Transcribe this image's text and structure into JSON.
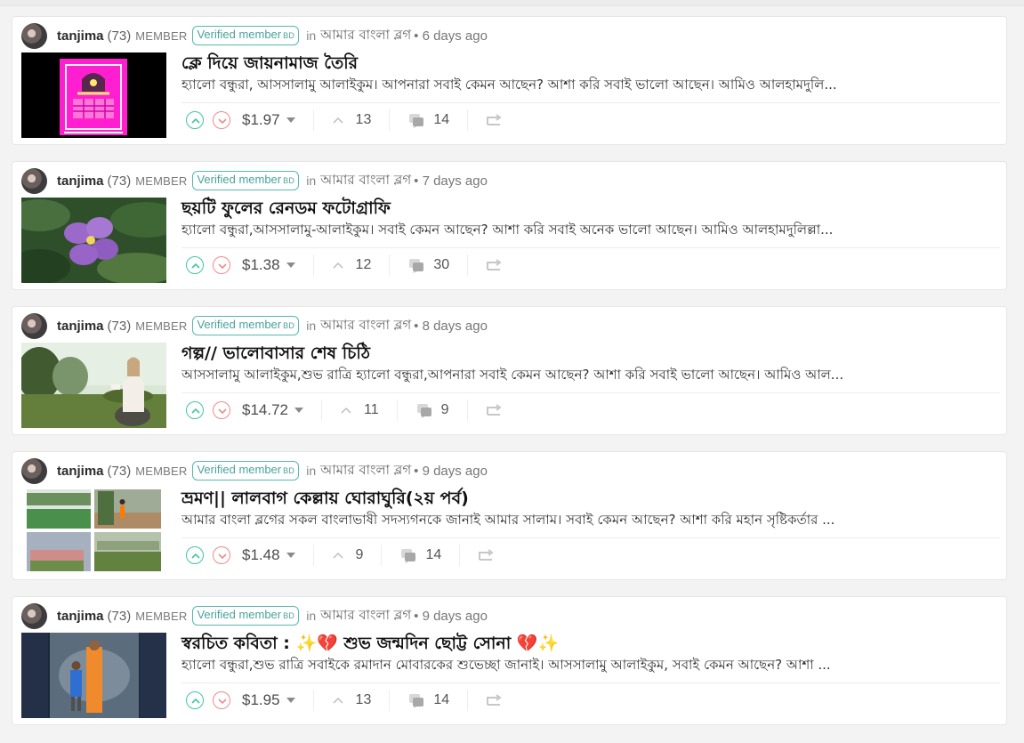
{
  "posts": [
    {
      "author": "tanjima",
      "reputation": "(73)",
      "role": "MEMBER",
      "badge_main": "Verified member",
      "badge_suffix": "BD",
      "in_label": "in",
      "community": "আমার বাংলা ব্লগ",
      "time": "• 6 days ago",
      "title": "ক্লে দিয়ে জায়নামাজ তৈরি",
      "excerpt": "হ্যালো বন্ধুরা, আসসালামু আলাইকুম। আপনারা সবাই কেমন আছেন? আশা করি সবাই ভালো আছেন। আমিও আলহামদুলি...",
      "payout": "$1.97",
      "votes": "13",
      "comments": "14",
      "thumb_type": "prayer-mat-clay"
    },
    {
      "author": "tanjima",
      "reputation": "(73)",
      "role": "MEMBER",
      "badge_main": "Verified member",
      "badge_suffix": "BD",
      "in_label": "in",
      "community": "আমার বাংলা ব্লগ",
      "time": "• 7 days ago",
      "title": "ছয়টি ফুলের রেনডম ফটোগ্রাফি",
      "excerpt": "হ্যালো বন্ধুরা,আসসালামু-আলাইকুম। সবাই কেমন আছেন? আশা করি সবাই অনেক ভালো আছেন। আমিও আলহামদুলিল্লা...",
      "payout": "$1.38",
      "votes": "12",
      "comments": "30",
      "thumb_type": "purple-flower"
    },
    {
      "author": "tanjima",
      "reputation": "(73)",
      "role": "MEMBER",
      "badge_main": "Verified member",
      "badge_suffix": "BD",
      "in_label": "in",
      "community": "আমার বাংলা ব্লগ",
      "time": "• 8 days ago",
      "title": "গল্প// ভালোবাসার শেষ চিঠি",
      "excerpt": "আসসালামু আলাইকুম,শুভ রাত্রি হ্যালো বন্ধুরা,আপনারা সবাই কেমন আছেন? আশা করি সবাই ভালো আছেন। আমিও আল...",
      "payout": "$14.72",
      "votes": "11",
      "comments": "9",
      "thumb_type": "woman-field"
    },
    {
      "author": "tanjima",
      "reputation": "(73)",
      "role": "MEMBER",
      "badge_main": "Verified member",
      "badge_suffix": "BD",
      "in_label": "in",
      "community": "আমার বাংলা ব্লগ",
      "time": "• 9 days ago",
      "title": "ভ্রমণ|| লালবাগ কেল্লায় ঘোরাঘুরি(২য় পর্ব)",
      "excerpt": "আমার বাংলা ব্লগের সকল বাংলাভাষী সদস্যগনকে জানাই আমার সালাম। সবাই কেমন আছেন? আশা করি মহান সৃষ্টিকর্তার ...",
      "payout": "$1.48",
      "votes": "9",
      "comments": "14",
      "thumb_type": "travel-grid"
    },
    {
      "author": "tanjima",
      "reputation": "(73)",
      "role": "MEMBER",
      "badge_main": "Verified member",
      "badge_suffix": "BD",
      "in_label": "in",
      "community": "আমার বাংলা ব্লগ",
      "time": "• 9 days ago",
      "title": "স্বরচিত কবিতা : ✨💔 শুভ জন্মদিন ছোট্ট সোনা 💔✨",
      "excerpt": "হ্যালো বন্ধুরা,শুভ রাত্রি সবাইকে রমাদান মোবারকের শুভেচ্ছা জানাই। আসসালামু আলাইকুম, সবাই কেমন আছেন? আশা ...",
      "payout": "$1.95",
      "votes": "13",
      "comments": "14",
      "thumb_type": "mother-child"
    }
  ],
  "colors": {
    "upvote": "#40c6a0",
    "downvote": "#ef8a8a",
    "badge": "#56b9ae"
  }
}
